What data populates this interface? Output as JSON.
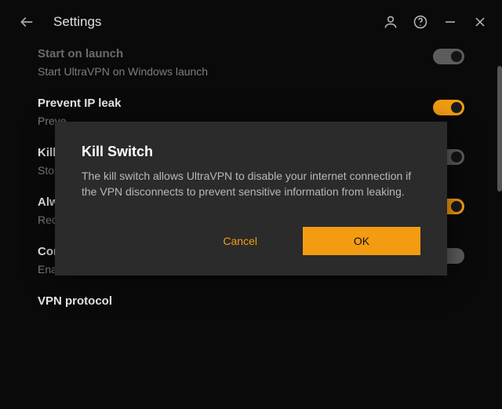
{
  "titlebar": {
    "title": "Settings"
  },
  "settings": [
    {
      "title": "Start on launch",
      "desc": "Start UltraVPN on Windows launch",
      "toggle": "gray-on"
    },
    {
      "title": "Prevent IP leak",
      "desc": "Preve",
      "toggle": "on"
    },
    {
      "title": "Kill Switch",
      "desc": "Stop a",
      "toggle": "gray-on"
    },
    {
      "title": "Alway",
      "desc": "Recor",
      "toggle": "on"
    },
    {
      "title": "Connection quality feedback",
      "desc": "Enable feedback on connection quality",
      "toggle": "gray-off"
    },
    {
      "title": "VPN protocol",
      "desc": "",
      "toggle": null
    }
  ],
  "modal": {
    "title": "Kill Switch",
    "text": "The kill switch allows UltraVPN to disable your internet connection if the VPN disconnects to prevent sensitive information from leaking.",
    "cancel": "Cancel",
    "ok": "OK"
  }
}
